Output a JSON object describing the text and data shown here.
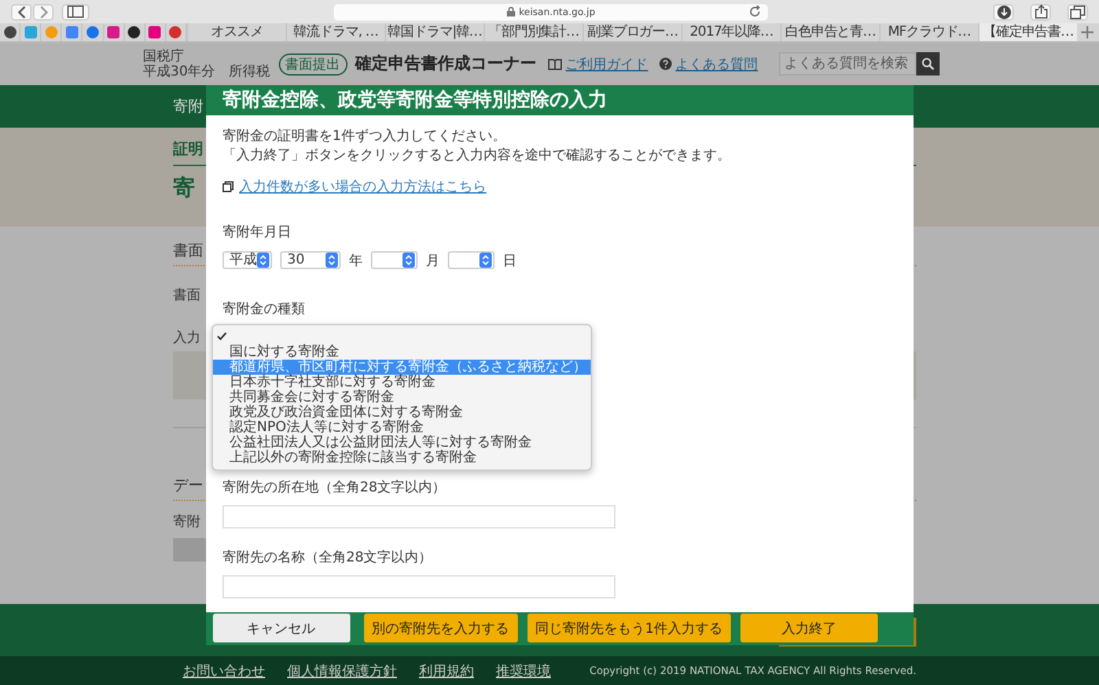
{
  "browser": {
    "url": "keisan.nta.go.jp",
    "tabs": [
      {
        "label": "オススメ",
        "selected": false
      },
      {
        "label": "韓流ドラマ, …",
        "selected": false
      },
      {
        "label": "韓国ドラマ|韓…",
        "selected": false
      },
      {
        "label": "「部門別集計…",
        "selected": false
      },
      {
        "label": "副業ブロガー…",
        "selected": false
      },
      {
        "label": "2017年以降…",
        "selected": false
      },
      {
        "label": "白色申告と青…",
        "selected": false
      },
      {
        "label": "MFクラウド…",
        "selected": false
      },
      {
        "label": "【確定申告書…",
        "selected": true
      }
    ]
  },
  "header": {
    "agency": "国税庁",
    "year": "平成30年分　所得税",
    "badge": "書面提出",
    "title": "確定申告書作成コーナー",
    "guide_link": "ご利用ガイド",
    "faq_link": "よくある質問",
    "search": {
      "placeholder": "よくある質問を検索"
    }
  },
  "background_page": {
    "nav_text": "寄附",
    "step": "証明",
    "page_title": "寄",
    "section_1": "書面",
    "label_1": "書面",
    "label_2": "入力",
    "section_2": "デー",
    "label_3": "寄附"
  },
  "modal": {
    "title": "寄附金控除、政党等寄附金等特別控除の入力",
    "intro": [
      "寄附金の証明書を1件ずつ入力してください。",
      "「入力終了」ボタンをクリックすると入力内容を途中で確認することができます。"
    ],
    "help_link": "入力件数が多い場合の入力方法はこちら",
    "date": {
      "label": "寄附年月日",
      "selects": [
        {
          "value": "平成"
        },
        {
          "value": "30",
          "unit": "年"
        },
        {
          "unit": "月"
        },
        {
          "unit": "日"
        }
      ]
    },
    "type": {
      "label": "寄附金の種類",
      "options": [
        {
          "checked": true,
          "selected": false
        },
        {
          "label": "国に対する寄附金",
          "checked": false,
          "selected": false
        },
        {
          "label": "都道府県、市区町村に対する寄附金（ふるさと納税など）",
          "checked": false,
          "selected": true
        },
        {
          "label": "日本赤十字社支部に対する寄附金",
          "checked": false,
          "selected": false
        },
        {
          "label": "共同募金会に対する寄附金",
          "checked": false,
          "selected": false
        },
        {
          "label": "政党及び政治資金団体に対する寄附金",
          "checked": false,
          "selected": false
        },
        {
          "label": "認定NPO法人等に対する寄附金",
          "checked": false,
          "selected": false
        },
        {
          "label": "公益社団法人又は公益財団法人等に対する寄附金",
          "checked": false,
          "selected": false
        },
        {
          "label": "上記以外の寄附金控除に該当する寄附金",
          "checked": false,
          "selected": false
        }
      ]
    },
    "fields": [
      {
        "label": "寄附先の所在地（全角28文字以内）"
      },
      {
        "label": "寄附先の名称（全角28文字以内）"
      }
    ],
    "buttons": [
      {
        "label": "キャンセル",
        "kind": "secondary"
      },
      {
        "label": "別の寄附先を入力する",
        "kind": "primary"
      },
      {
        "label": "同じ寄附先をもう1件入力する",
        "kind": "primary"
      },
      {
        "label": "入力終了",
        "kind": "primary"
      }
    ]
  },
  "footer": {
    "links": [
      "お問い合わせ",
      "個人情報保護方針",
      "利用規約",
      "推奨環境"
    ],
    "copyright": "Copyright (c) 2019 NATIONAL TAX AGENCY All Rights Reserved."
  }
}
